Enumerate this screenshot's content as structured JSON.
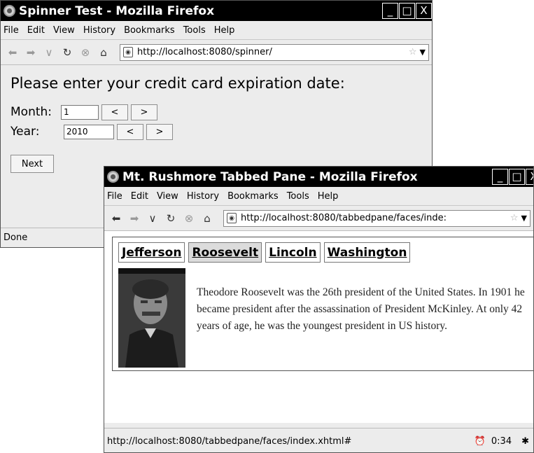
{
  "window1": {
    "title": "Spinner Test - Mozilla Firefox",
    "menu": [
      "File",
      "Edit",
      "View",
      "History",
      "Bookmarks",
      "Tools",
      "Help"
    ],
    "url": "http://localhost:8080/spinner/",
    "heading": "Please enter your credit card expiration date:",
    "month_label": "Month:",
    "month_value": "1",
    "year_label": "Year:",
    "year_value": "2010",
    "dec_label": "<",
    "inc_label": ">",
    "next_label": "Next",
    "status": "Done"
  },
  "window2": {
    "title": "Mt. Rushmore Tabbed Pane - Mozilla Firefox",
    "menu": [
      "File",
      "Edit",
      "View",
      "History",
      "Bookmarks",
      "Tools",
      "Help"
    ],
    "url": "http://localhost:8080/tabbedpane/faces/inde:",
    "tabs": [
      "Jefferson",
      "Roosevelt",
      "Lincoln",
      "Washington"
    ],
    "selected_tab": "Roosevelt",
    "bio": "Theodore Roosevelt was the 26th president of the United States. In 1901 he became president after the assassination of President McKinley. At only 42 years of age, he was the youngest president in US history.",
    "status_url": "http://localhost:8080/tabbedpane/faces/index.xhtml#",
    "clock": "0:34"
  },
  "wm_buttons": [
    "_",
    "□",
    "X"
  ],
  "icons": {
    "back": "back-arrow-icon",
    "forward": "forward-arrow-icon",
    "dropdown": "history-dropdown-icon",
    "reload": "reload-icon",
    "stop": "stop-icon",
    "home": "home-icon",
    "bookmark": "star-icon"
  }
}
